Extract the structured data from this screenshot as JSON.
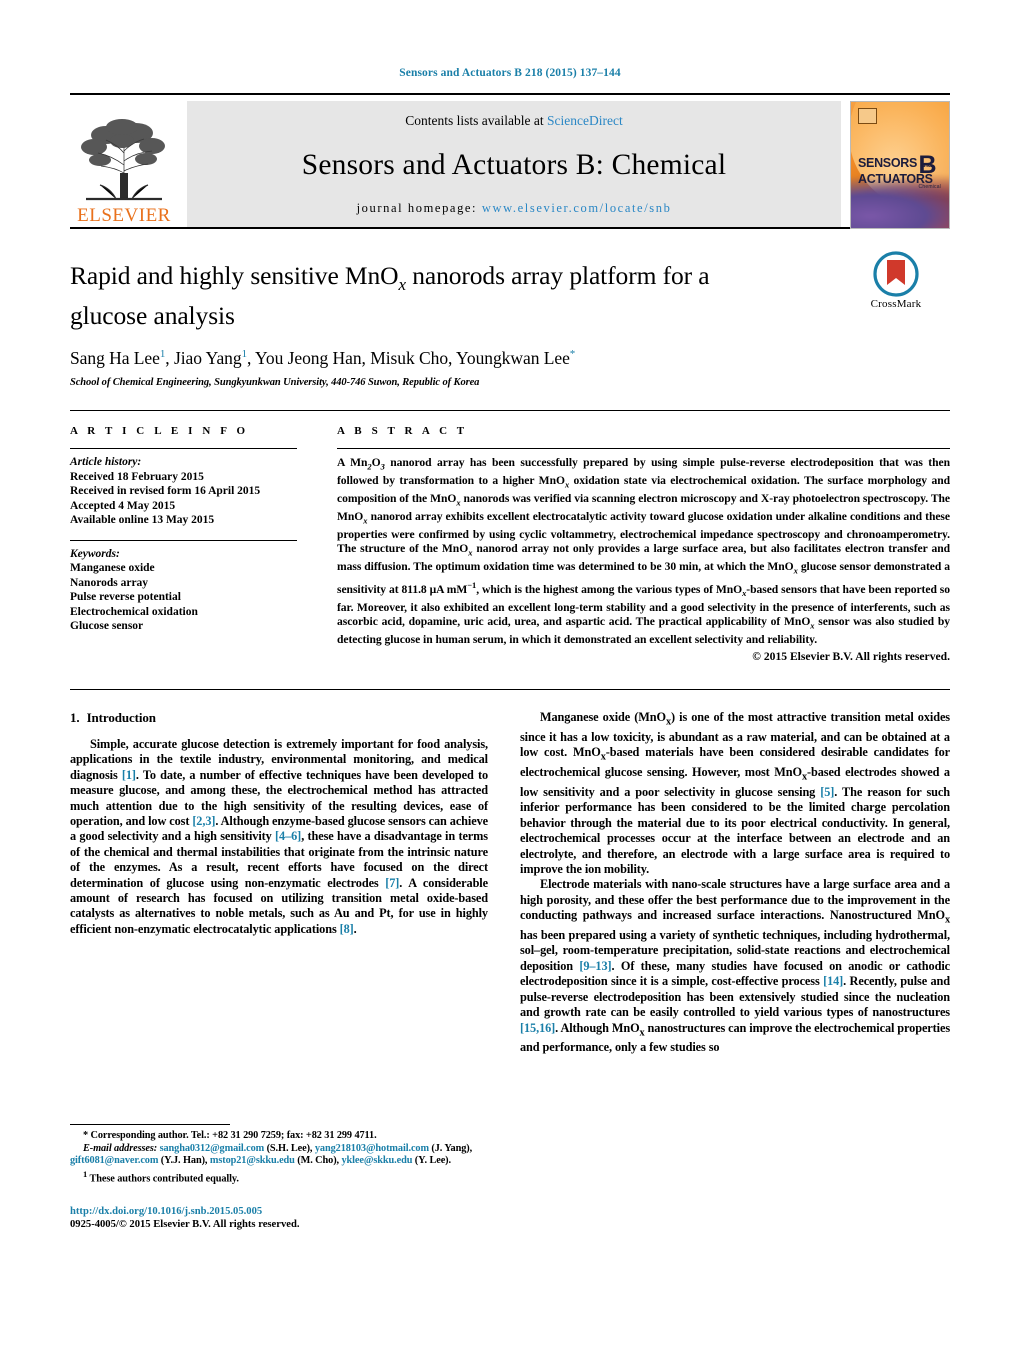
{
  "running_head": "Sensors and Actuators B 218 (2015) 137–144",
  "masthead": {
    "publisher": "ELSEVIER",
    "contents_prefix": "Contents lists available at ",
    "contents_link": "ScienceDirect",
    "journal_title": "Sensors and Actuators B: Chemical",
    "homepage_prefix": "journal homepage: ",
    "homepage_url": "www.elsevier.com/locate/snb",
    "cover": {
      "line1": "SENSORS",
      "and": "and",
      "line2": "ACTUATORS",
      "volume_letter": "B",
      "volume_sub": "Chemical"
    }
  },
  "article": {
    "title_part1": "Rapid and highly sensitive MnO",
    "title_sub": "x",
    "title_part2": " nanorods array platform for a glucose analysis",
    "authors": "Sang Ha Lee",
    "authors_full": "Sang Ha Lee¹, Jiao Yang¹, You Jeong Han, Misuk Cho, Youngkwan Lee*",
    "author_list": [
      {
        "name": "Sang Ha Lee",
        "mark": "1"
      },
      {
        "name": "Jiao Yang",
        "mark": "1"
      },
      {
        "name": "You Jeong Han",
        "mark": ""
      },
      {
        "name": "Misuk Cho",
        "mark": ""
      },
      {
        "name": "Youngkwan Lee",
        "mark": "*"
      }
    ],
    "affiliation": "School of Chemical Engineering, Sungkyunkwan University, 440-746 Suwon, Republic of Korea",
    "crossmark_label": "CrossMark"
  },
  "article_info": {
    "heading": "A R T I C L E   I N F O",
    "history_label": "Article history:",
    "history": [
      "Received 18 February 2015",
      "Received in revised form 16 April 2015",
      "Accepted 4 May 2015",
      "Available online 13 May 2015"
    ],
    "keywords_label": "Keywords:",
    "keywords": [
      "Manganese oxide",
      "Nanorods array",
      "Pulse reverse potential",
      "Electrochemical oxidation",
      "Glucose sensor"
    ]
  },
  "abstract": {
    "heading": "A B S T R A C T",
    "text_segments": [
      {
        "t": "A Mn"
      },
      {
        "sub": "2"
      },
      {
        "t": "O"
      },
      {
        "sub": "3"
      },
      {
        "t": " nanorod array has been successfully prepared by using simple pulse-reverse electrodeposition that was then followed by transformation to a higher MnO"
      },
      {
        "sub": "x"
      },
      {
        "t": " oxidation state via electrochemical oxidation. The surface morphology and composition of the MnO"
      },
      {
        "sub": "x"
      },
      {
        "t": " nanorods was verified via scanning electron microscopy and X-ray photoelectron spectroscopy. The MnO"
      },
      {
        "sub": "x"
      },
      {
        "t": " nanorod array exhibits excellent electrocatalytic activity toward glucose oxidation under alkaline conditions and these properties were confirmed by using cyclic voltammetry, electrochemical impedance spectroscopy and chronoamperometry. The structure of the MnO"
      },
      {
        "sub": "x"
      },
      {
        "t": " nanorod array not only provides a large surface area, but also facilitates electron transfer and mass diffusion. The optimum oxidation time was determined to be 30 min, at which the MnO"
      },
      {
        "sub": "x"
      },
      {
        "t": " glucose sensor demonstrated a sensitivity at 811.8 μA mM"
      },
      {
        "sup": "−1"
      },
      {
        "t": ", which is the highest among the various types of MnO"
      },
      {
        "sub": "x"
      },
      {
        "t": "-based sensors that have been reported so far. Moreover, it also exhibited an excellent long-term stability and a good selectivity in the presence of interferents, such as ascorbic acid, dopamine, uric acid, urea, and aspartic acid. The practical applicability of MnO"
      },
      {
        "sub": "x"
      },
      {
        "t": " sensor was also studied by detecting glucose in human serum, in which it demonstrated an excellent selectivity and reliability."
      }
    ],
    "copyright": "© 2015 Elsevier B.V. All rights reserved."
  },
  "introduction": {
    "heading_num": "1.",
    "heading_text": "Introduction",
    "left_paragraphs": [
      [
        {
          "t": "Simple, accurate glucose detection is extremely important for food analysis, applications in the textile industry, environmental monitoring, and medical diagnosis "
        },
        {
          "ref": "[1]"
        },
        {
          "t": ". To date, a number of effective techniques have been developed to measure glucose, and among these, the electrochemical method has attracted much attention due to the high sensitivity of the resulting devices, ease of operation, and low cost "
        },
        {
          "ref": "[2,3]"
        },
        {
          "t": ". Although enzyme-based glucose sensors can achieve a good selectivity and a high sensitivity "
        },
        {
          "ref": "[4–6]"
        },
        {
          "t": ", these have a disadvantage in terms of the chemical and thermal instabilities that originate from the intrinsic nature of the enzymes. As a result, recent efforts have focused on the direct determination of glucose using non-enzymatic electrodes "
        },
        {
          "ref": "[7]"
        },
        {
          "t": ". A considerable amount of research has focused on utilizing transition metal oxide-based catalysts as alternatives to noble metals, such as Au and Pt, for use in highly efficient non-enzymatic electrocatalytic applications "
        },
        {
          "ref": "[8]"
        },
        {
          "t": "."
        }
      ]
    ],
    "right_paragraphs": [
      [
        {
          "t": "Manganese oxide (MnO"
        },
        {
          "sub": "x"
        },
        {
          "t": ") is one of the most attractive transition metal oxides since it has a low toxicity, is abundant as a raw material, and can be obtained at a low cost. MnO"
        },
        {
          "sub": "x"
        },
        {
          "t": "-based materials have been considered desirable candidates for electrochemical glucose sensing. However, most MnO"
        },
        {
          "sub": "x"
        },
        {
          "t": "-based electrodes showed a low sensitivity and a poor selectivity in glucose sensing "
        },
        {
          "ref": "[5]"
        },
        {
          "t": ". The reason for such inferior performance has been considered to be the limited charge percolation behavior through the material due to its poor electrical conductivity. In general, electrochemical processes occur at the interface between an electrode and an electrolyte, and therefore, an electrode with a large surface area is required to improve the ion mobility."
        }
      ],
      [
        {
          "t": "Electrode materials with nano-scale structures have a large surface area and a high porosity, and these offer the best performance due to the improvement in the conducting pathways and increased surface interactions. Nanostructured MnO"
        },
        {
          "sub": "x"
        },
        {
          "t": " has been prepared using a variety of synthetic techniques, including hydrothermal, sol–gel, room-temperature precipitation, solid-state reactions and electrochemical deposition "
        },
        {
          "ref": "[9–13]"
        },
        {
          "t": ". Of these, many studies have focused on anodic or cathodic electrodeposition since it is a simple, cost-effective process "
        },
        {
          "ref": "[14]"
        },
        {
          "t": ". Recently, pulse and pulse-reverse electrodeposition has been extensively studied since the nucleation and growth rate can be easily controlled to yield various types of nanostructures "
        },
        {
          "ref": "[15,16]"
        },
        {
          "t": ". Although MnO"
        },
        {
          "sub": "x"
        },
        {
          "t": " nanostructures can improve the electrochemical properties and performance, only a few studies so"
        }
      ]
    ]
  },
  "footnotes": {
    "corresponding": "* Corresponding author. Tel.: +82 31 290 7259; fax: +82 31 299 4711.",
    "email_label": "E-mail addresses:",
    "emails": [
      {
        "addr": "sangha0312@gmail.com",
        "owner": "(S.H. Lee)"
      },
      {
        "addr": "yang218103@hotmail.com",
        "owner": "(J. Yang)"
      },
      {
        "addr": "gift6081@naver.com",
        "owner": "(Y.J. Han)"
      },
      {
        "addr": "mstop21@skku.edu",
        "owner": "(M. Cho)"
      },
      {
        "addr": "yklee@skku.edu",
        "owner": "(Y. Lee)"
      }
    ],
    "equal_contrib_mark": "1",
    "equal_contrib": "These authors contributed equally.",
    "doi_url": "http://dx.doi.org/10.1016/j.snb.2015.05.005",
    "issn_line": "0925-4005/© 2015 Elsevier B.V. All rights reserved."
  },
  "colors": {
    "link": "#1a7fa8",
    "sciencedirect": "#2a87c5",
    "elsevier_orange": "#E9711C"
  }
}
